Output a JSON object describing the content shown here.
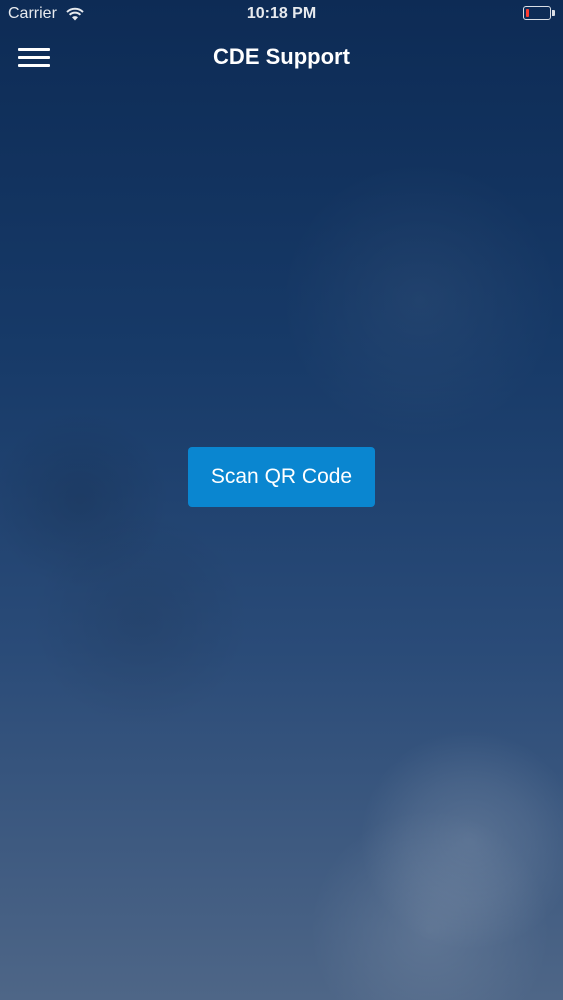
{
  "status_bar": {
    "carrier": "Carrier",
    "time": "10:18 PM",
    "wifi_icon": "wifi-icon",
    "battery_icon": "battery-low-icon",
    "battery_color": "#ff3b30"
  },
  "nav_bar": {
    "title": "CDE Support",
    "menu_icon": "hamburger-menu-icon"
  },
  "main": {
    "scan_button_label": "Scan QR Code",
    "button_color": "#0a86d0"
  },
  "colors": {
    "background_top": "#0d2b55",
    "background_bottom": "#4e6687",
    "text": "#ffffff"
  }
}
